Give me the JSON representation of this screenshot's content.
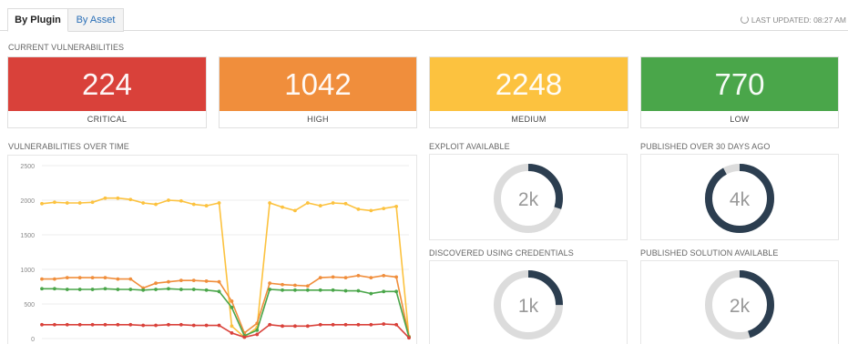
{
  "tabs": [
    {
      "label": "By Plugin"
    },
    {
      "label": "By Asset"
    }
  ],
  "last_updated": "LAST UPDATED: 08:27 AM",
  "current_vulns": {
    "title": "CURRENT VULNERABILITIES",
    "cards": [
      {
        "value": "224",
        "label": "CRITICAL",
        "color": "#d9413a"
      },
      {
        "value": "1042",
        "label": "HIGH",
        "color": "#f08e3c"
      },
      {
        "value": "2248",
        "label": "MEDIUM",
        "color": "#fcc23f"
      },
      {
        "value": "770",
        "label": "LOW",
        "color": "#4aa64a"
      }
    ]
  },
  "over_time": {
    "title": "VULNERABILITIES OVER TIME"
  },
  "donuts": [
    {
      "title": "EXPLOIT AVAILABLE",
      "value": "2k",
      "fraction": 0.3
    },
    {
      "title": "PUBLISHED OVER 30 DAYS AGO",
      "value": "4k",
      "fraction": 0.92
    },
    {
      "title": "DISCOVERED USING CREDENTIALS",
      "value": "1k",
      "fraction": 0.25
    },
    {
      "title": "PUBLISHED SOLUTION AVAILABLE",
      "value": "2k",
      "fraction": 0.45
    }
  ],
  "colors": {
    "donut_fill": "#2c3e50",
    "donut_track": "#dcdcdc"
  },
  "chart_data": {
    "type": "line",
    "ylim": [
      0,
      2500
    ],
    "yticks": [
      "0",
      "500",
      "1000",
      "1500",
      "2000",
      "2500"
    ],
    "grid": true,
    "series": [
      {
        "color": "#fcc23f",
        "values": [
          1950,
          1970,
          1960,
          1960,
          1970,
          2030,
          2030,
          2010,
          1960,
          1940,
          2000,
          1990,
          1940,
          1920,
          1960,
          180,
          20,
          160,
          1960,
          1900,
          1850,
          1960,
          1920,
          1960,
          1950,
          1870,
          1850,
          1880,
          1910,
          20
        ]
      },
      {
        "color": "#f08e3c",
        "values": [
          860,
          860,
          880,
          880,
          880,
          880,
          860,
          860,
          730,
          800,
          820,
          840,
          840,
          830,
          820,
          540,
          80,
          220,
          800,
          780,
          770,
          760,
          880,
          890,
          880,
          910,
          880,
          910,
          890,
          30
        ]
      },
      {
        "color": "#4aa64a",
        "values": [
          720,
          720,
          710,
          710,
          710,
          720,
          710,
          710,
          700,
          710,
          720,
          710,
          710,
          700,
          680,
          450,
          40,
          120,
          710,
          700,
          700,
          700,
          700,
          700,
          690,
          690,
          650,
          680,
          680,
          20
        ]
      },
      {
        "color": "#d9413a",
        "values": [
          200,
          200,
          200,
          200,
          200,
          200,
          200,
          200,
          190,
          190,
          200,
          200,
          190,
          190,
          190,
          80,
          20,
          60,
          200,
          180,
          180,
          180,
          200,
          200,
          200,
          200,
          200,
          210,
          200,
          10
        ]
      }
    ]
  }
}
